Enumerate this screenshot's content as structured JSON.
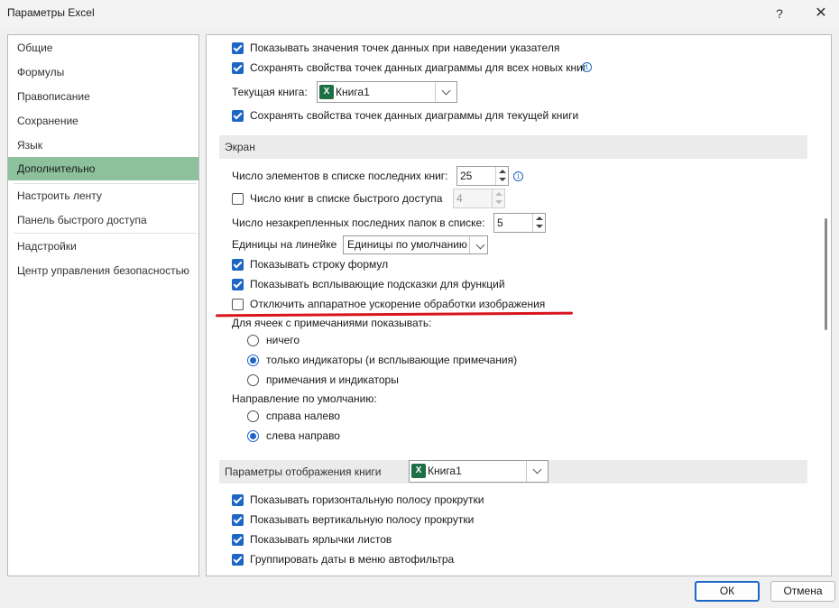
{
  "window": {
    "title": "Параметры Excel",
    "help": "?",
    "close": "✕"
  },
  "nav": {
    "items": [
      {
        "label": "Общие"
      },
      {
        "label": "Формулы"
      },
      {
        "label": "Правописание"
      },
      {
        "label": "Сохранение"
      },
      {
        "label": "Язык"
      },
      {
        "label": "Дополнительно",
        "active": true
      },
      {
        "label": "Настроить ленту"
      },
      {
        "label": "Панель быстрого доступа"
      },
      {
        "label": "Надстройки"
      },
      {
        "label": "Центр управления безопасностью"
      }
    ]
  },
  "chart_section": {
    "show_values_hover": "Показывать значения точек данных при наведении указателя",
    "save_props_all": "Сохранять свойства точек данных диаграммы для всех новых книг",
    "current_book_label": "Текущая книга:",
    "current_book_value": "Книга1",
    "save_props_current": "Сохранять свойства точек данных диаграммы для текущей книги"
  },
  "screen_section": {
    "header": "Экран",
    "recent_books_label": "Число элементов в списке последних книг:",
    "recent_books_value": "25",
    "quick_access_label": "Число книг в списке быстрого доступа",
    "quick_access_value": "4",
    "unpinned_folders_label": "Число незакрепленных последних папок в списке:",
    "unpinned_folders_value": "5",
    "ruler_units_label": "Единицы на линейке",
    "ruler_units_value": "Единицы по умолчанию",
    "show_formula_bar": "Показывать строку формул",
    "show_function_tips": "Показывать всплывающие подсказки для функций",
    "disable_hw_accel": "Отключить аппаратное ускорение обработки изображения",
    "comments_label": "Для ячеек с примечаниями показывать:",
    "comments_none": "ничего",
    "comments_indicators": "только индикаторы (и всплывающие примечания)",
    "comments_both": "примечания и индикаторы",
    "direction_label": "Направление по умолчанию:",
    "direction_rtl": "справа налево",
    "direction_ltr": "слева направо"
  },
  "workbook_section": {
    "header": "Параметры отображения книги",
    "book_value": "Книга1",
    "show_hscroll": "Показывать горизонтальную полосу прокрутки",
    "show_vscroll": "Показывать вертикальную полосу прокрутки",
    "show_sheet_tabs": "Показывать ярлычки листов",
    "group_dates": "Группировать даты в меню автофильтра"
  },
  "buttons": {
    "ok": "ОК",
    "cancel": "Отмена"
  },
  "colors": {
    "accent": "#1e66c6",
    "nav_active": "#8cc19b",
    "annotation": "#d8141d"
  }
}
